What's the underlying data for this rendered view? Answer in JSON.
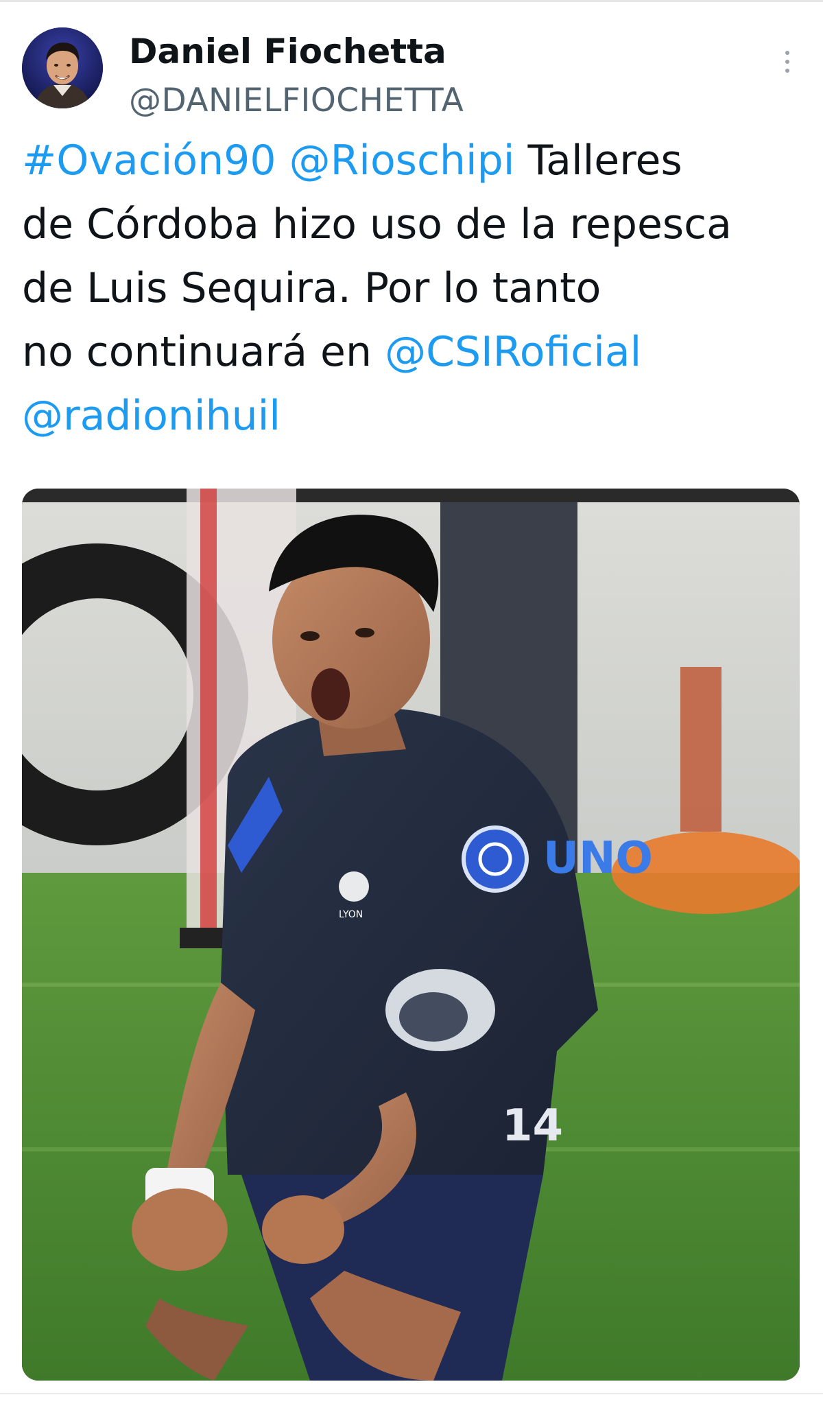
{
  "tweet": {
    "author": {
      "display_name": "Daniel Fiochetta",
      "handle": "@DANIELFIOCHETTA"
    },
    "text_lines": [
      [
        {
          "text": "#Ovación90",
          "link": true
        },
        {
          "text": " ",
          "link": false
        },
        {
          "text": "@Rioschipi",
          "link": true
        },
        {
          "text": " Talleres",
          "link": false
        }
      ],
      [
        {
          "text": "de Córdoba hizo uso de la repesca",
          "link": false
        }
      ],
      [
        {
          "text": "de Luis Sequira. Por lo tanto",
          "link": false
        }
      ],
      [
        {
          "text": "no continuará en ",
          "link": false
        },
        {
          "text": "@CSIRoficial",
          "link": true
        }
      ],
      [
        {
          "text": "@radionihuil",
          "link": true
        }
      ]
    ],
    "media": {
      "kit_sponsor": "UNO",
      "kit_brand": "LYON",
      "shirt_number": "14"
    }
  },
  "icons": {
    "menu": "more-vertical-icon"
  },
  "colors": {
    "link": "#1d9bf0",
    "text": "#0f1419",
    "handle": "#536471"
  }
}
